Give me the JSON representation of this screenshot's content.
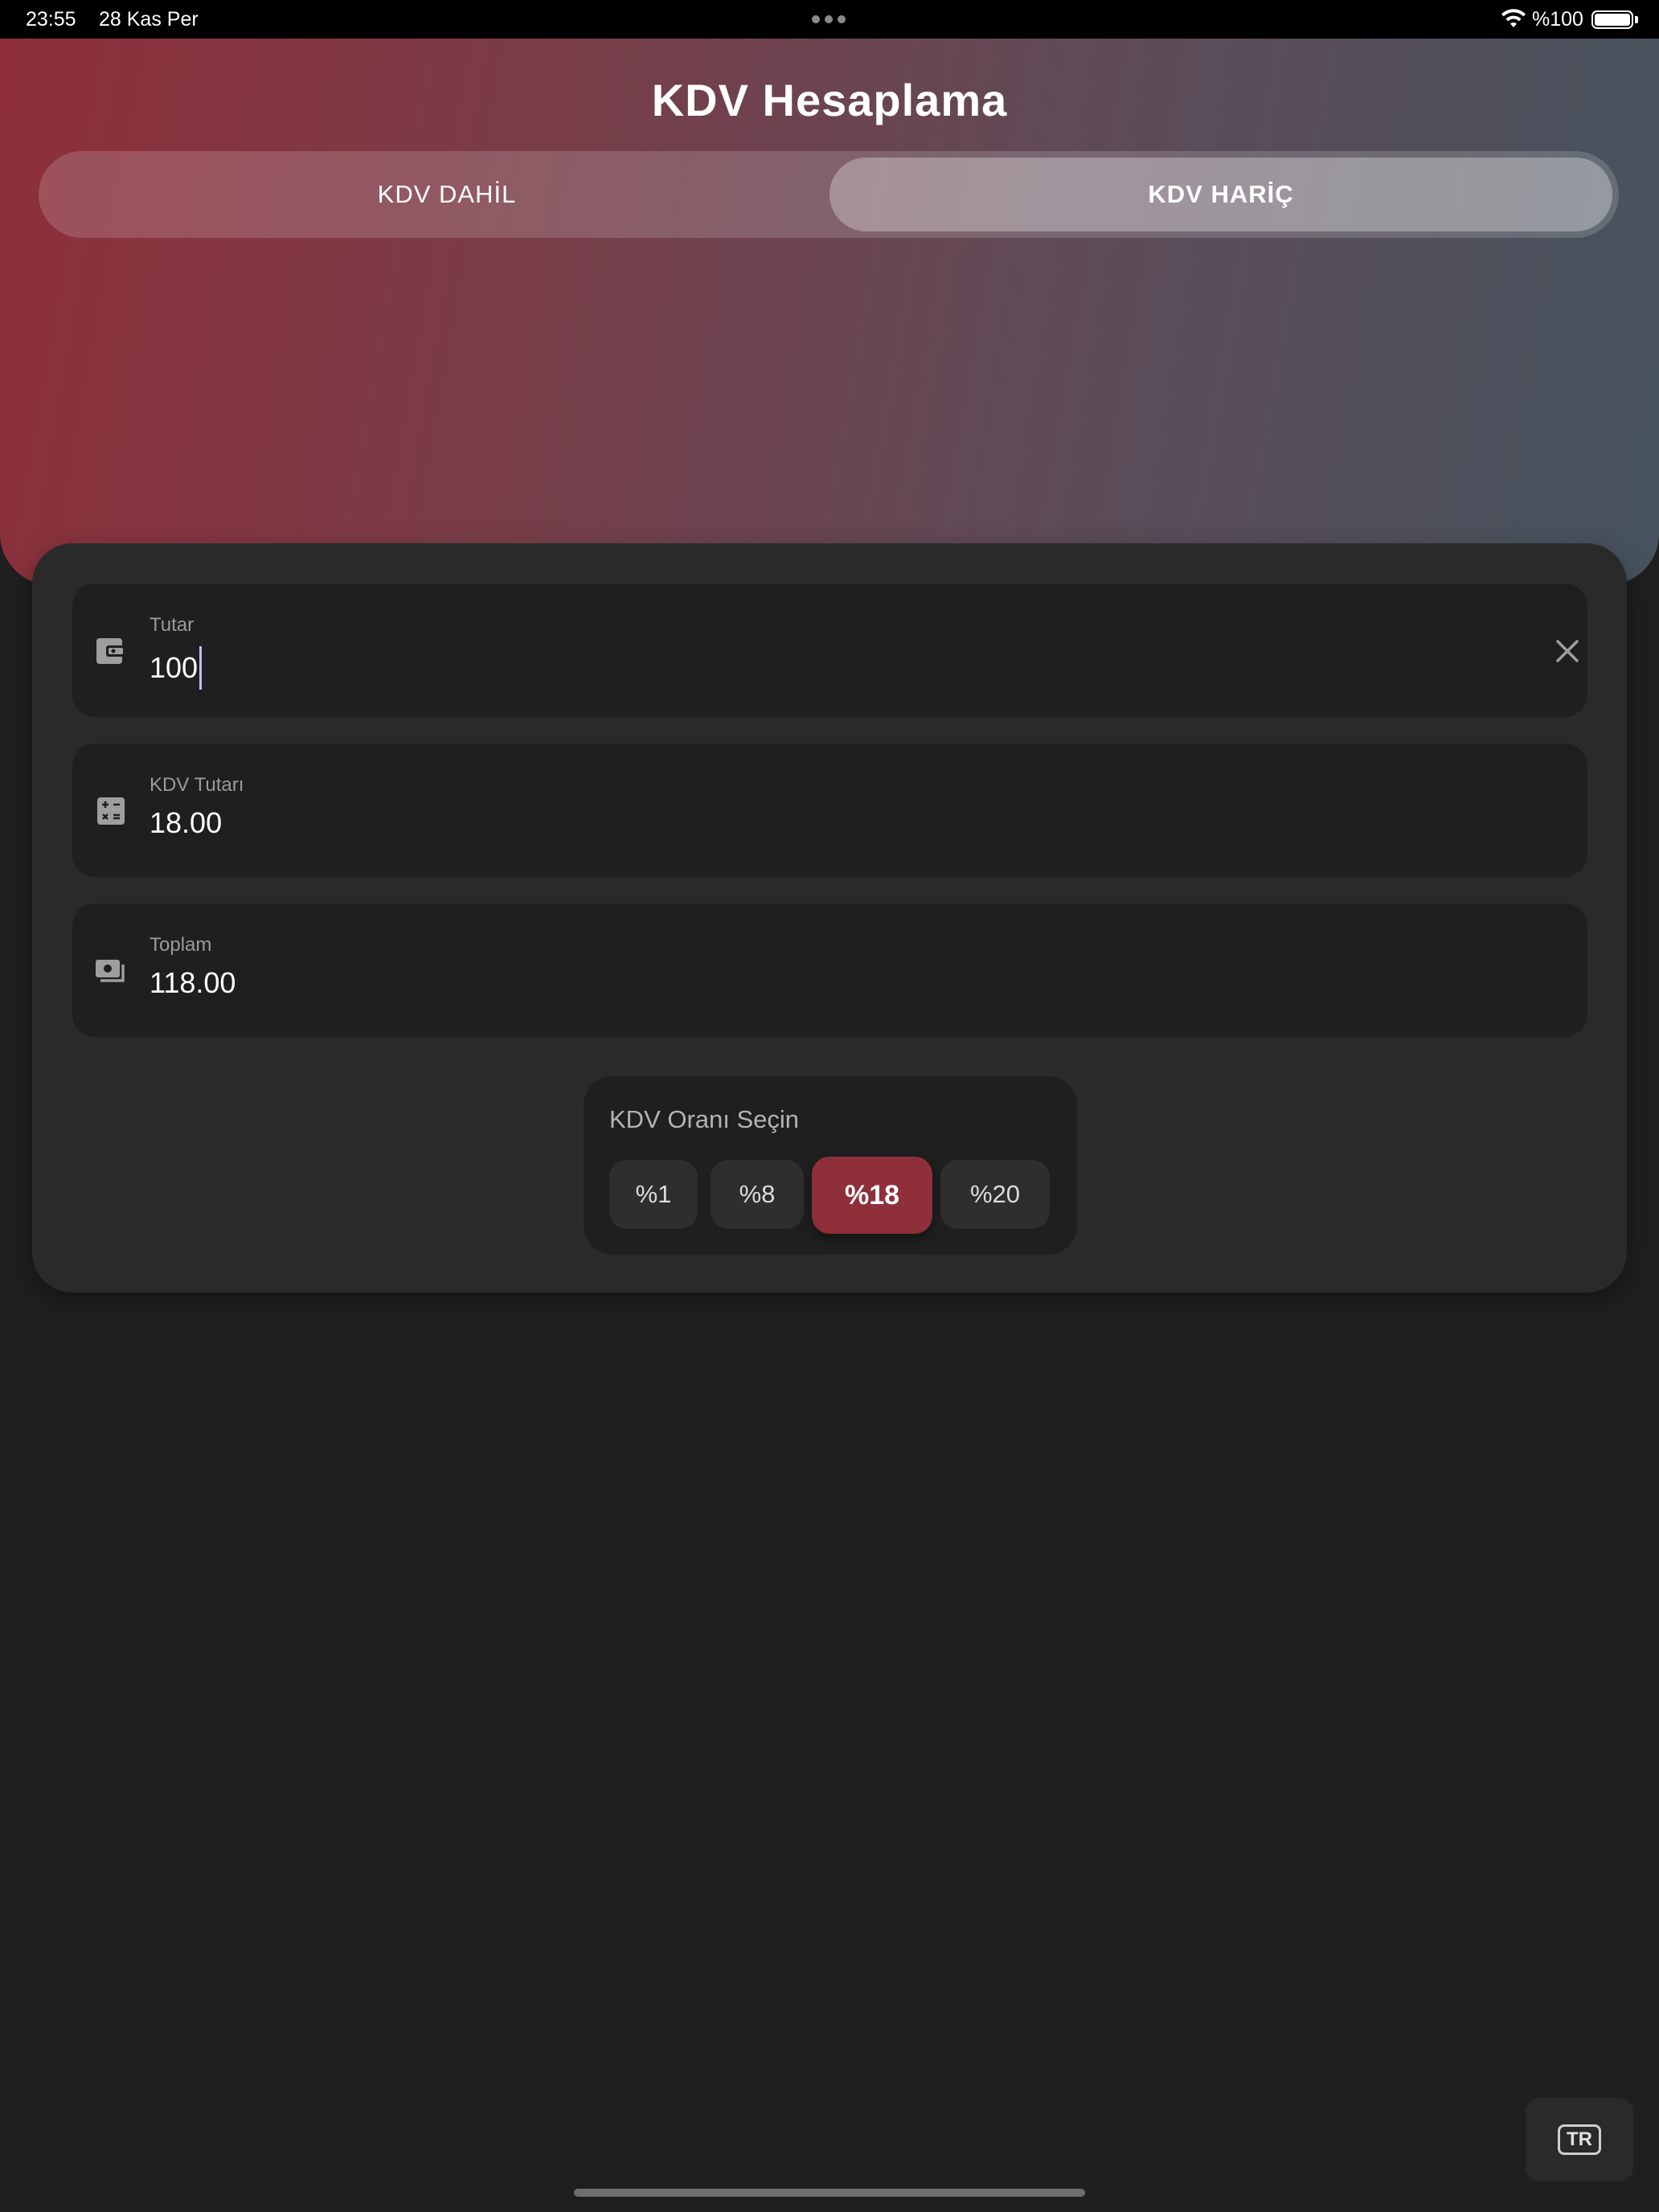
{
  "status_bar": {
    "time": "23:55",
    "date": "28 Kas Per",
    "battery_text": "%100"
  },
  "header": {
    "title": "KDV Hesaplama",
    "tabs": [
      {
        "label": "KDV DAHİL",
        "selected": false
      },
      {
        "label": "KDV HARİÇ",
        "selected": true
      }
    ]
  },
  "fields": {
    "amount": {
      "label": "Tutar",
      "value": "100",
      "icon": "wallet-icon"
    },
    "vat_amount": {
      "label": "KDV Tutarı",
      "value": "18.00",
      "icon": "calculator-icon"
    },
    "total": {
      "label": "Toplam",
      "value": "118.00",
      "icon": "money-icon"
    }
  },
  "rate_selector": {
    "title": "KDV Oranı Seçin",
    "options": [
      {
        "label": "%1",
        "selected": false
      },
      {
        "label": "%8",
        "selected": false
      },
      {
        "label": "%18",
        "selected": true
      },
      {
        "label": "%20",
        "selected": false
      }
    ]
  },
  "language_button": {
    "label": "TR"
  },
  "colors": {
    "accent": "#8e2f3a",
    "background": "#1f1f1f",
    "card": "#2a2a2a"
  }
}
